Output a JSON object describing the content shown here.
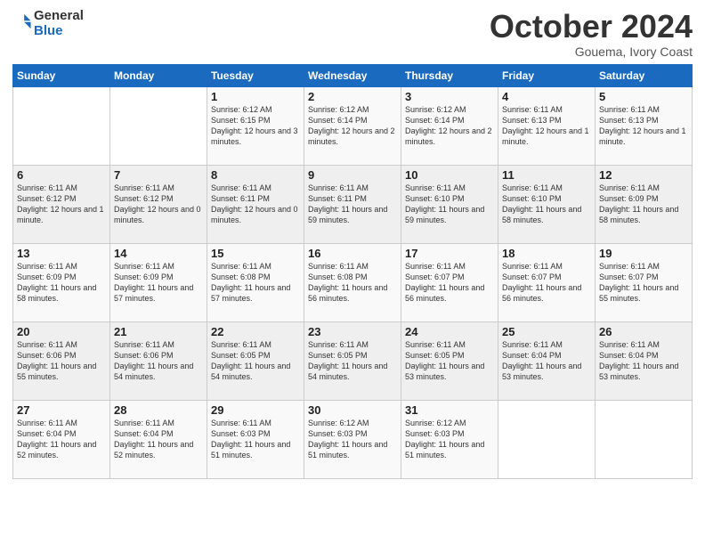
{
  "header": {
    "logo_general": "General",
    "logo_blue": "Blue",
    "month": "October 2024",
    "location": "Gouema, Ivory Coast"
  },
  "weekdays": [
    "Sunday",
    "Monday",
    "Tuesday",
    "Wednesday",
    "Thursday",
    "Friday",
    "Saturday"
  ],
  "weeks": [
    [
      {
        "day": "",
        "info": ""
      },
      {
        "day": "",
        "info": ""
      },
      {
        "day": "1",
        "info": "Sunrise: 6:12 AM\nSunset: 6:15 PM\nDaylight: 12 hours and 3 minutes."
      },
      {
        "day": "2",
        "info": "Sunrise: 6:12 AM\nSunset: 6:14 PM\nDaylight: 12 hours and 2 minutes."
      },
      {
        "day": "3",
        "info": "Sunrise: 6:12 AM\nSunset: 6:14 PM\nDaylight: 12 hours and 2 minutes."
      },
      {
        "day": "4",
        "info": "Sunrise: 6:11 AM\nSunset: 6:13 PM\nDaylight: 12 hours and 1 minute."
      },
      {
        "day": "5",
        "info": "Sunrise: 6:11 AM\nSunset: 6:13 PM\nDaylight: 12 hours and 1 minute."
      }
    ],
    [
      {
        "day": "6",
        "info": "Sunrise: 6:11 AM\nSunset: 6:12 PM\nDaylight: 12 hours and 1 minute."
      },
      {
        "day": "7",
        "info": "Sunrise: 6:11 AM\nSunset: 6:12 PM\nDaylight: 12 hours and 0 minutes."
      },
      {
        "day": "8",
        "info": "Sunrise: 6:11 AM\nSunset: 6:11 PM\nDaylight: 12 hours and 0 minutes."
      },
      {
        "day": "9",
        "info": "Sunrise: 6:11 AM\nSunset: 6:11 PM\nDaylight: 11 hours and 59 minutes."
      },
      {
        "day": "10",
        "info": "Sunrise: 6:11 AM\nSunset: 6:10 PM\nDaylight: 11 hours and 59 minutes."
      },
      {
        "day": "11",
        "info": "Sunrise: 6:11 AM\nSunset: 6:10 PM\nDaylight: 11 hours and 58 minutes."
      },
      {
        "day": "12",
        "info": "Sunrise: 6:11 AM\nSunset: 6:09 PM\nDaylight: 11 hours and 58 minutes."
      }
    ],
    [
      {
        "day": "13",
        "info": "Sunrise: 6:11 AM\nSunset: 6:09 PM\nDaylight: 11 hours and 58 minutes."
      },
      {
        "day": "14",
        "info": "Sunrise: 6:11 AM\nSunset: 6:09 PM\nDaylight: 11 hours and 57 minutes."
      },
      {
        "day": "15",
        "info": "Sunrise: 6:11 AM\nSunset: 6:08 PM\nDaylight: 11 hours and 57 minutes."
      },
      {
        "day": "16",
        "info": "Sunrise: 6:11 AM\nSunset: 6:08 PM\nDaylight: 11 hours and 56 minutes."
      },
      {
        "day": "17",
        "info": "Sunrise: 6:11 AM\nSunset: 6:07 PM\nDaylight: 11 hours and 56 minutes."
      },
      {
        "day": "18",
        "info": "Sunrise: 6:11 AM\nSunset: 6:07 PM\nDaylight: 11 hours and 56 minutes."
      },
      {
        "day": "19",
        "info": "Sunrise: 6:11 AM\nSunset: 6:07 PM\nDaylight: 11 hours and 55 minutes."
      }
    ],
    [
      {
        "day": "20",
        "info": "Sunrise: 6:11 AM\nSunset: 6:06 PM\nDaylight: 11 hours and 55 minutes."
      },
      {
        "day": "21",
        "info": "Sunrise: 6:11 AM\nSunset: 6:06 PM\nDaylight: 11 hours and 54 minutes."
      },
      {
        "day": "22",
        "info": "Sunrise: 6:11 AM\nSunset: 6:05 PM\nDaylight: 11 hours and 54 minutes."
      },
      {
        "day": "23",
        "info": "Sunrise: 6:11 AM\nSunset: 6:05 PM\nDaylight: 11 hours and 54 minutes."
      },
      {
        "day": "24",
        "info": "Sunrise: 6:11 AM\nSunset: 6:05 PM\nDaylight: 11 hours and 53 minutes."
      },
      {
        "day": "25",
        "info": "Sunrise: 6:11 AM\nSunset: 6:04 PM\nDaylight: 11 hours and 53 minutes."
      },
      {
        "day": "26",
        "info": "Sunrise: 6:11 AM\nSunset: 6:04 PM\nDaylight: 11 hours and 53 minutes."
      }
    ],
    [
      {
        "day": "27",
        "info": "Sunrise: 6:11 AM\nSunset: 6:04 PM\nDaylight: 11 hours and 52 minutes."
      },
      {
        "day": "28",
        "info": "Sunrise: 6:11 AM\nSunset: 6:04 PM\nDaylight: 11 hours and 52 minutes."
      },
      {
        "day": "29",
        "info": "Sunrise: 6:11 AM\nSunset: 6:03 PM\nDaylight: 11 hours and 51 minutes."
      },
      {
        "day": "30",
        "info": "Sunrise: 6:12 AM\nSunset: 6:03 PM\nDaylight: 11 hours and 51 minutes."
      },
      {
        "day": "31",
        "info": "Sunrise: 6:12 AM\nSunset: 6:03 PM\nDaylight: 11 hours and 51 minutes."
      },
      {
        "day": "",
        "info": ""
      },
      {
        "day": "",
        "info": ""
      }
    ]
  ]
}
